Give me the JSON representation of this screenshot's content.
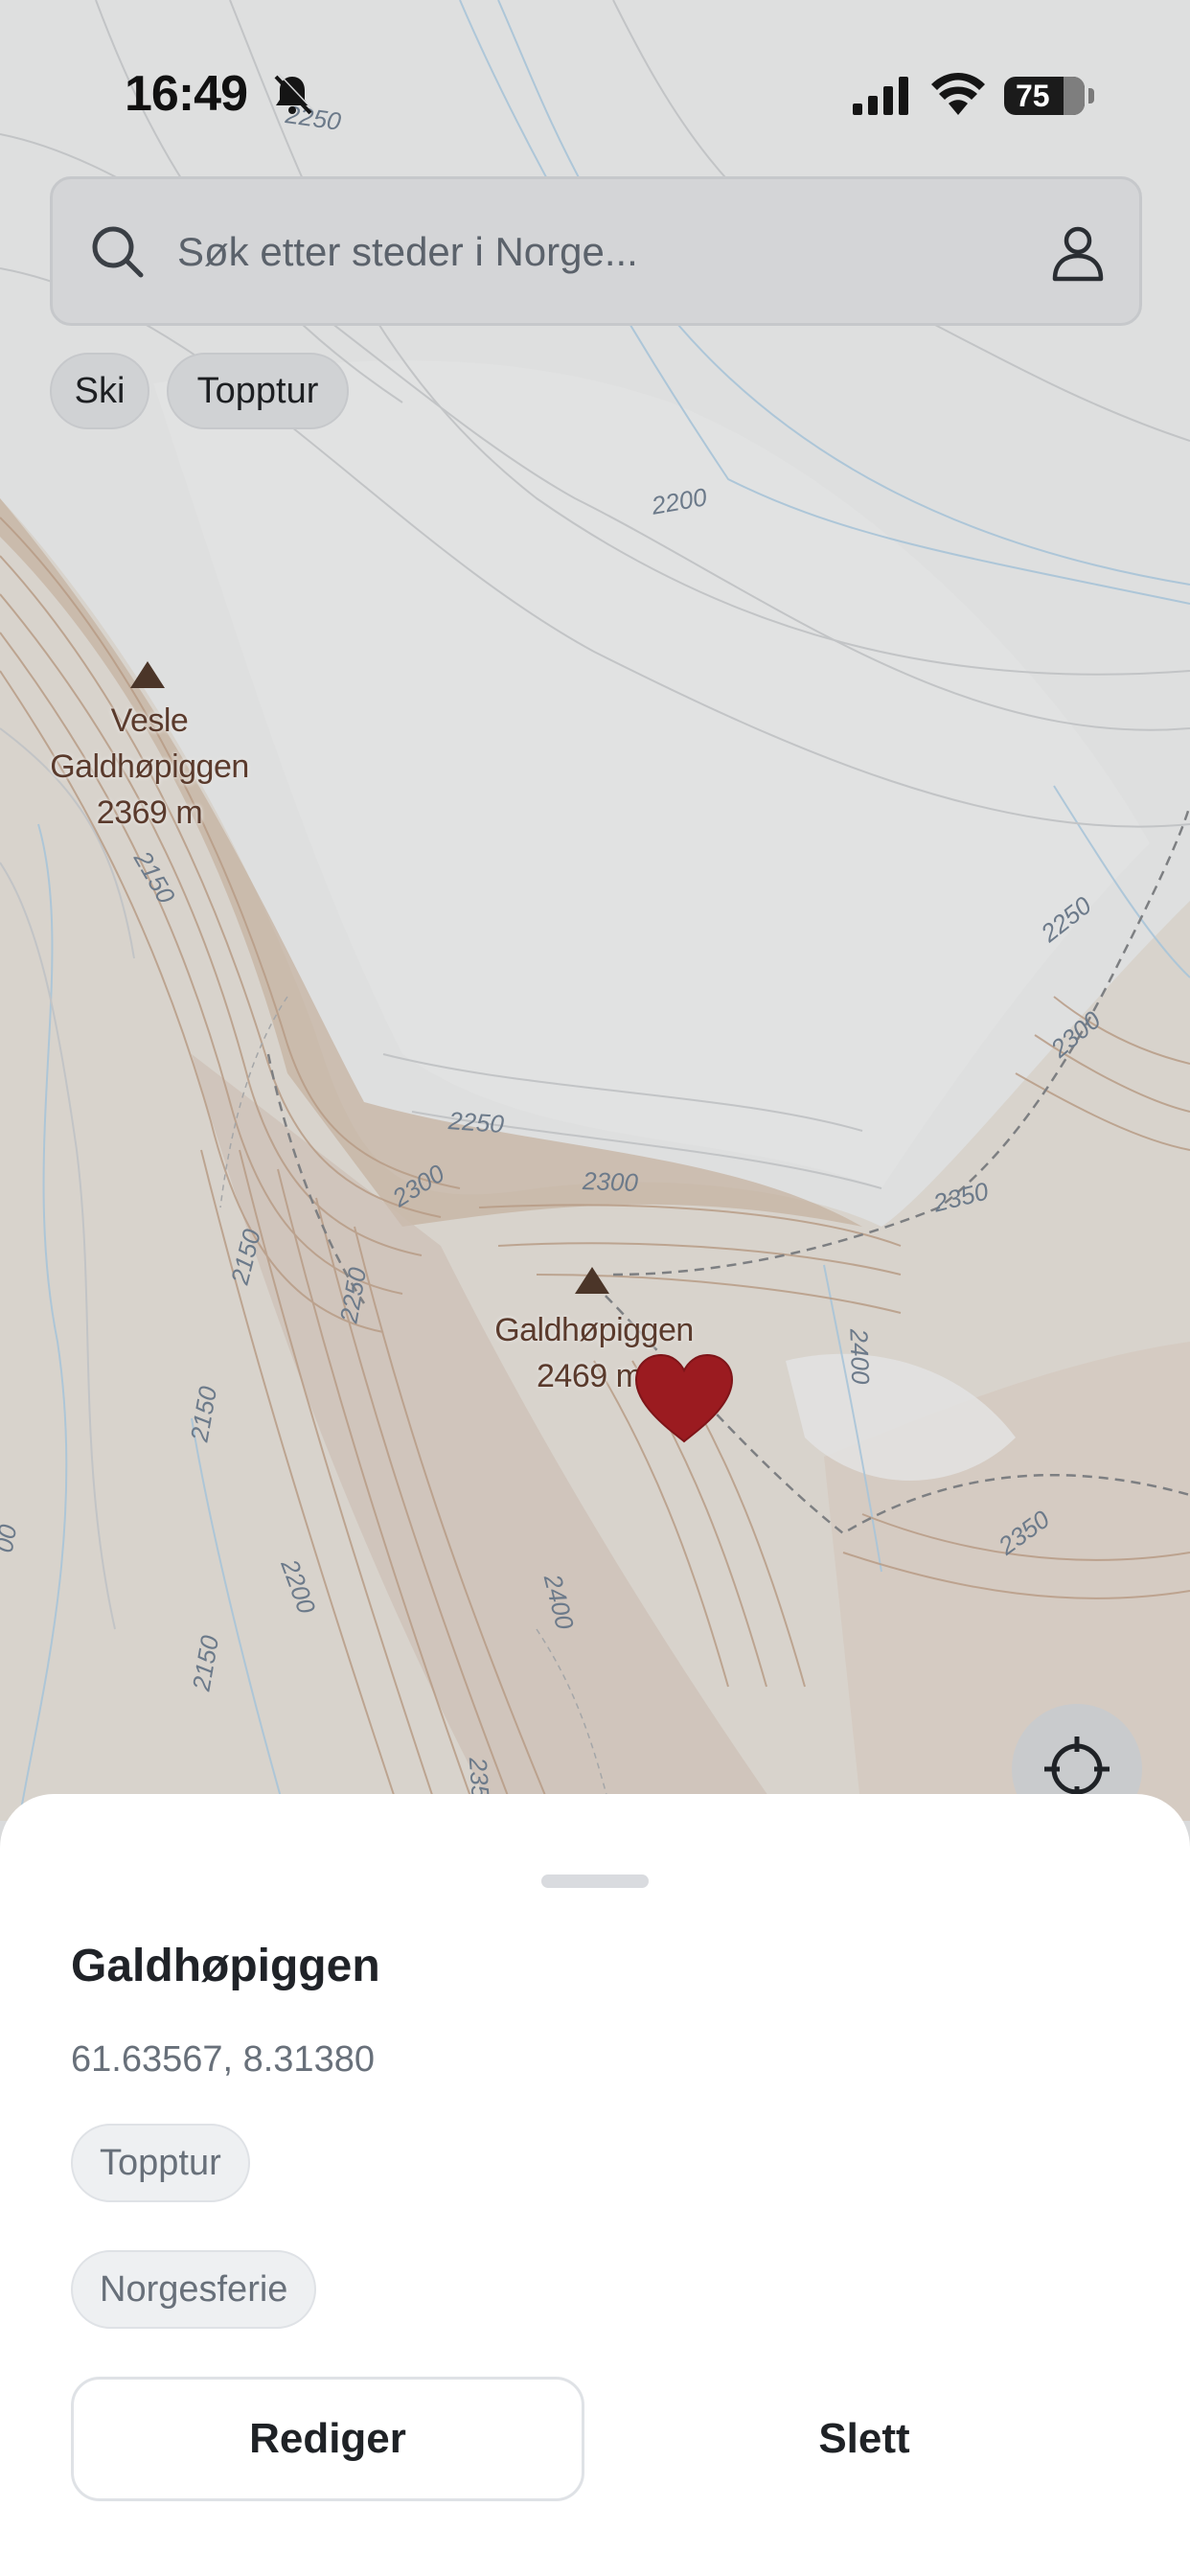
{
  "status_bar": {
    "time": "16:49",
    "battery": "75",
    "icons": [
      "bell-slash-icon",
      "signal-icon",
      "wifi-icon",
      "battery-icon"
    ]
  },
  "search": {
    "placeholder": "Søk etter steder i Norge...",
    "value": ""
  },
  "filters": [
    "Ski",
    "Topptur"
  ],
  "map": {
    "peaks": [
      {
        "name_lines": [
          "Vesle",
          "Galdhøpiggen",
          "2369 m"
        ]
      },
      {
        "name_lines": [
          "Galdhøpiggen",
          "2469 m"
        ]
      }
    ],
    "contour_labels": [
      "2250",
      "2200",
      "2150",
      "2250",
      "2300",
      "2250",
      "2300",
      "2300",
      "2350",
      "2150",
      "2250",
      "2400",
      "2150",
      "2200",
      "2400",
      "2350",
      "2150",
      "235",
      "00"
    ],
    "marker": "heart-marker-icon"
  },
  "sheet": {
    "title": "Galdhøpiggen",
    "coordinates": "61.63567, 8.31380",
    "tags": [
      "Topptur",
      "Norgesferie"
    ],
    "edit_label": "Rediger",
    "delete_label": "Slett"
  },
  "colors": {
    "marker": "#9b1b20",
    "peak": "#4b3528",
    "contour_brown": "#b59a83",
    "water_blue": "#9ec0d8",
    "sheet_bg": "#ffffff"
  }
}
